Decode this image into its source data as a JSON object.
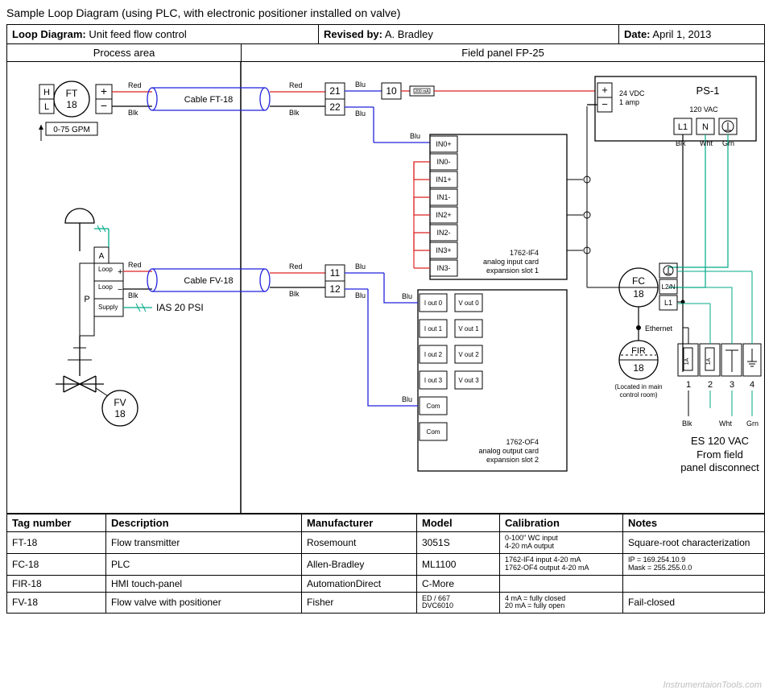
{
  "title": "Sample Loop Diagram (using PLC, with electronic positioner installed on valve)",
  "header": {
    "loop_label": "Loop Diagram:",
    "loop_value": "Unit feed flow control",
    "revised_label": "Revised by:",
    "revised_value": "A. Bradley",
    "date_label": "Date:",
    "date_value": "April 1, 2013"
  },
  "zones": {
    "process": "Process area",
    "panel": "Field panel FP-25"
  },
  "labels": {
    "H": "H",
    "L": "L",
    "FT": "FT",
    "FT_tag": "18",
    "range": "0-75 GPM",
    "plus": "+",
    "minus": "−",
    "Red": "Red",
    "Blk": "Blk",
    "Blu": "Blu",
    "Wht": "Wht",
    "Grn": "Grn",
    "cable_ft": "Cable FT-18",
    "cable_fv": "Cable FV-18",
    "t21": "21",
    "t22": "22",
    "t10": "10",
    "mA": "200 mA",
    "t11": "11",
    "t12": "12",
    "IN0p": "IN0+",
    "IN0m": "IN0-",
    "IN1p": "IN1+",
    "IN1m": "IN1-",
    "IN2p": "IN2+",
    "IN2m": "IN2-",
    "IN3p": "IN3+",
    "IN3m": "IN3-",
    "Iout0": "I out 0",
    "Vout0": "V out 0",
    "Iout1": "I out 1",
    "Vout1": "V out 1",
    "Iout2": "I out 2",
    "Vout2": "V out 2",
    "Iout3": "I out 3",
    "Vout3": "V out 3",
    "Com": "Com",
    "ai_card": "1762-IF4",
    "ai_card2": "analog input card",
    "ai_card3": "expansion slot 1",
    "ao_card": "1762-OF4",
    "ao_card2": "analog output card",
    "ao_card3": "expansion slot 2",
    "PS": "PS-1",
    "v24": "24 VDC",
    "amp1": "1 amp",
    "v120": "120 VAC",
    "L1": "L1",
    "N": "N",
    "L2N": "L2/N",
    "FC": "FC",
    "FC_tag": "18",
    "FIR": "FIR",
    "FIR_tag": "18",
    "Ethernet": "Ethernet",
    "FIR_loc": "(Located in main",
    "FIR_loc2": "control room)",
    "es120": "ES 120 VAC",
    "fromfield": "From field",
    "pdisc": "panel disconnect",
    "n1": "1",
    "n2": "2",
    "n3": "3",
    "n4": "4",
    "fuse": "1A",
    "A": "A",
    "P": "P",
    "Loop": "Loop",
    "Supply": "Supply",
    "IAS": "IAS 20 PSI",
    "FV": "FV",
    "FV_tag": "18",
    "ground": "⏚"
  },
  "table": {
    "head": [
      "Tag number",
      "Description",
      "Manufacturer",
      "Model",
      "Calibration",
      "Notes"
    ],
    "rows": [
      {
        "tag": "FT-18",
        "desc": "Flow transmitter",
        "mfr": "Rosemount",
        "model": "3051S",
        "cal": "0-100\" WC input\n4-20 mA output",
        "notes": "Square-root characterization"
      },
      {
        "tag": "FC-18",
        "desc": "PLC",
        "mfr": "Allen-Bradley",
        "model": "ML1100",
        "cal": "1762-IF4 input     4-20 mA\n1762-OF4 output  4-20 mA",
        "notes": "IP = 169.254.10.9\nMask = 255.255.0.0"
      },
      {
        "tag": "FIR-18",
        "desc": "HMI touch-panel",
        "mfr": "AutomationDirect",
        "model": "C-More",
        "cal": "",
        "notes": ""
      },
      {
        "tag": "FV-18",
        "desc": "Flow valve with positioner",
        "mfr": "Fisher",
        "model": "ED / 667\nDVC6010",
        "cal": "4 mA = fully closed\n20 mA = fully open",
        "notes": "Fail-closed"
      }
    ]
  },
  "watermark": "InstrumentaionTools.com"
}
